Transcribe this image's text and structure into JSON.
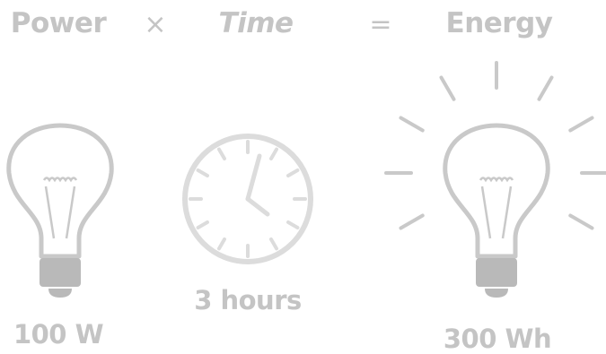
{
  "headings": {
    "power": "Power",
    "times": "×",
    "time": "Time",
    "equals": "=",
    "energy": "Energy"
  },
  "values": {
    "power": "100 W",
    "time": "3 hours",
    "energy": "300 Wh"
  },
  "icons": {
    "power": "light-bulb-icon",
    "time": "clock-icon",
    "energy": "glowing-light-bulb-icon"
  },
  "colors": {
    "text": "#c4c4c4",
    "bulb_outline": "#c9c9c9",
    "bulb_base": "#b9b9b9",
    "clock": "#dcdcdc"
  }
}
